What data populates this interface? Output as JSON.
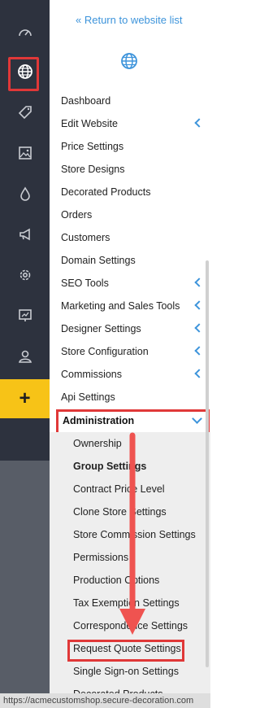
{
  "back_link": "« Return to website list",
  "rail_icons": [
    "gauge-icon",
    "globe-icon",
    "tag-icon",
    "image-icon",
    "drop-icon",
    "megaphone-icon",
    "gear-icon",
    "presentation-icon",
    "user-icon"
  ],
  "plus_label": "+",
  "nav": {
    "items": [
      {
        "label": "Dashboard",
        "chevron": false
      },
      {
        "label": "Edit Website",
        "chevron": true
      },
      {
        "label": "Price Settings",
        "chevron": false
      },
      {
        "label": "Store Designs",
        "chevron": false
      },
      {
        "label": "Decorated Products",
        "chevron": false
      },
      {
        "label": "Orders",
        "chevron": false
      },
      {
        "label": "Customers",
        "chevron": false
      },
      {
        "label": "Domain Settings",
        "chevron": false
      },
      {
        "label": "SEO Tools",
        "chevron": true
      },
      {
        "label": "Marketing and Sales Tools",
        "chevron": true
      },
      {
        "label": "Designer Settings",
        "chevron": true
      },
      {
        "label": "Store Configuration",
        "chevron": true
      },
      {
        "label": "Commissions",
        "chevron": true
      },
      {
        "label": "Api Settings",
        "chevron": false
      }
    ],
    "administration": "Administration"
  },
  "submenu": [
    "Ownership",
    "Group Settings",
    "Contract Price Level",
    "Clone Store Settings",
    "Store Commission Settings",
    "Permissions",
    "Production Options",
    "Tax Exemption Settings",
    "Correspondence Settings",
    "Request Quote Settings",
    "Single Sign-on Settings",
    "Decorated Products"
  ],
  "status_url": "https://acmecustomshop.secure-decoration.com",
  "colors": {
    "rail": "#2d323e",
    "accent": "#3d94db",
    "highlight": "#e03838",
    "plus": "#f7c317",
    "submenu_bg": "#eeeeee"
  }
}
